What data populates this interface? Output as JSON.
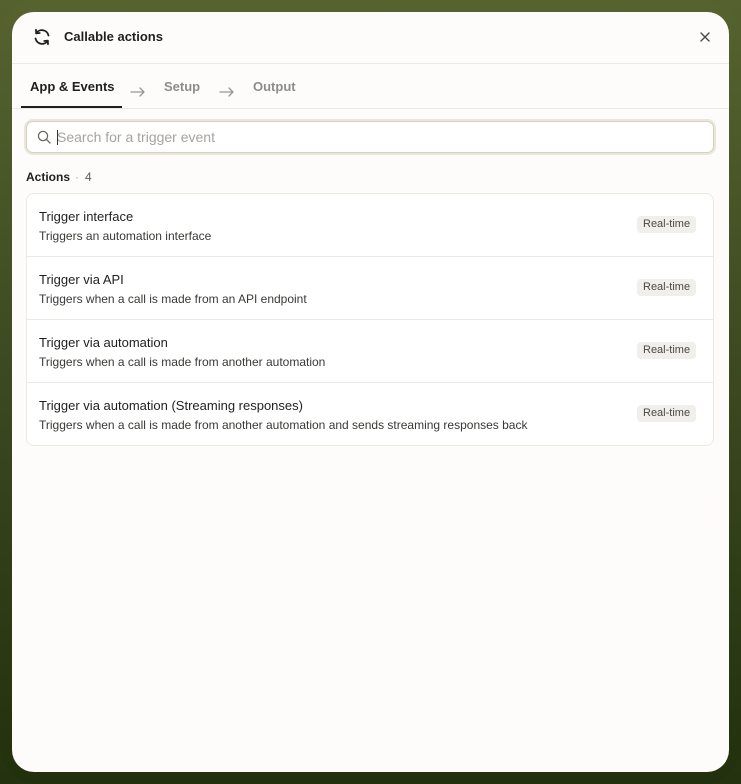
{
  "dialog": {
    "title": "Callable actions",
    "icon": "refresh-icon",
    "close_icon": "close-icon"
  },
  "steps": [
    {
      "label": "App & Events",
      "active": true
    },
    {
      "label": "Setup",
      "active": false
    },
    {
      "label": "Output",
      "active": false
    }
  ],
  "search": {
    "placeholder": "Search for a trigger event",
    "value": ""
  },
  "section": {
    "label": "Actions",
    "separator": "·",
    "count": "4"
  },
  "actions": [
    {
      "title": "Trigger interface",
      "description": "Triggers an automation interface",
      "badge": "Real-time"
    },
    {
      "title": "Trigger via API",
      "description": "Triggers when a call is made from an API endpoint",
      "badge": "Real-time"
    },
    {
      "title": "Trigger via automation",
      "description": "Triggers when a call is made from another automation",
      "badge": "Real-time"
    },
    {
      "title": "Trigger via automation (Streaming responses)",
      "description": "Triggers when a call is made from another automation and sends streaming responses back",
      "badge": "Real-time"
    }
  ]
}
